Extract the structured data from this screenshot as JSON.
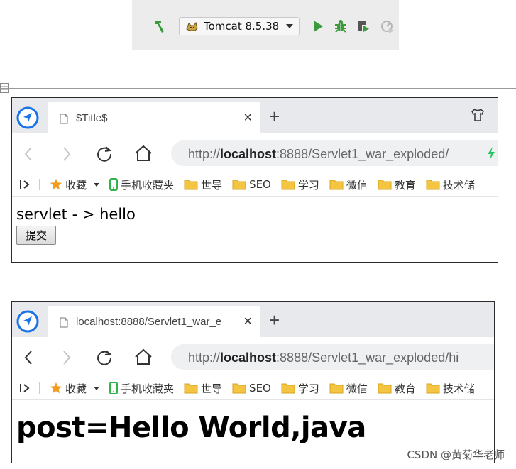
{
  "ide": {
    "run_config_label": "Tomcat 8.5.38"
  },
  "browser_top": {
    "tab_title": "$Title$",
    "tab_close": "×",
    "new_tab": "+",
    "url_prefix": "http://",
    "url_host": "localhost",
    "url_rest": ":8888/Servlet1_war_exploded/",
    "bookmarks": {
      "favorites": "收藏",
      "mobile": "手机收藏夹",
      "folder1": "世导",
      "folder2": "SEO",
      "folder3": "学习",
      "folder4": "微信",
      "folder5": "教育",
      "folder6": "技术储"
    },
    "page_text": "servlet - > hello",
    "submit_label": "提交"
  },
  "browser_bottom": {
    "tab_title": "localhost:8888/Servlet1_war_e",
    "tab_close": "×",
    "new_tab": "+",
    "url_prefix": "http://",
    "url_host": "localhost",
    "url_rest": ":8888/Servlet1_war_exploded/hi",
    "bookmarks": {
      "favorites": "收藏",
      "mobile": "手机收藏夹",
      "folder1": "世导",
      "folder2": "SEO",
      "folder3": "学习",
      "folder4": "微信",
      "folder5": "教育",
      "folder6": "技术储"
    },
    "page_heading": "post=Hello World,java"
  },
  "watermark": "CSDN @黄菊华老师",
  "colors": {
    "run_green": "#3c9a3c",
    "debug_green": "#3c9a3c",
    "browser_logo_blue": "#1a73e8",
    "folder_yellow": "#f3c541",
    "star_orange": "#f29b1d",
    "mobile_green": "#2fb34a"
  }
}
